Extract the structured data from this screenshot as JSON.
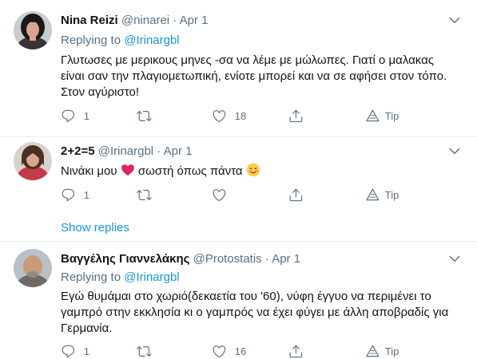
{
  "tweets": [
    {
      "name": "Nina Reizi",
      "handle": "@ninarei",
      "sep": "·",
      "date": "Apr 1",
      "replying_label": "Replying to",
      "replying_to": "@Irinargbl",
      "text_lines": [
        "Γλυτωσες με μερικους μηνες -σα να λέμε με μώλωπες. Γιατί ο μαλακας",
        "είναι σαν την πλαγιομετωπική, ενίοτε μπορεί και να σε αφήσει στον τόπο.",
        "Στον αγύριστο!"
      ],
      "replies": "1",
      "retweets": "",
      "likes": "18",
      "tip_label": "Tip"
    },
    {
      "name": "2+2=5",
      "handle": "@Irinargbl",
      "sep": "·",
      "date": "Apr 1",
      "text_before": "Νινάκι μου",
      "text_middle": "σωστή όπως πάντα",
      "emoji_1": "red-heart",
      "emoji_2": "smiling-face",
      "replies": "1",
      "retweets": "",
      "likes": "",
      "tip_label": "Tip"
    },
    {
      "name": "Βαγγέλης Γιαννελάκης",
      "handle": "@Protostatis",
      "sep": "·",
      "date": "Apr 1",
      "replying_label": "Replying to",
      "replying_to": "@Irinargbl",
      "text_lines": [
        "Εγώ θυμάμαι στο χωριό(δεκαετία του '60), νύφη έγγυο να περιμένει το",
        "γαμπρό στην εκκλησία κι ο γαμπρός να έχει φύγει με άλλη αποβραδίς για",
        "Γερμανία."
      ],
      "replies": "1",
      "retweets": "",
      "likes": "16",
      "tip_label": "Tip"
    }
  ],
  "show_replies": "Show replies",
  "colors": {
    "accent": "#1b95e0",
    "secondary_text": "#5b7083",
    "divider": "#e6ecf0"
  }
}
